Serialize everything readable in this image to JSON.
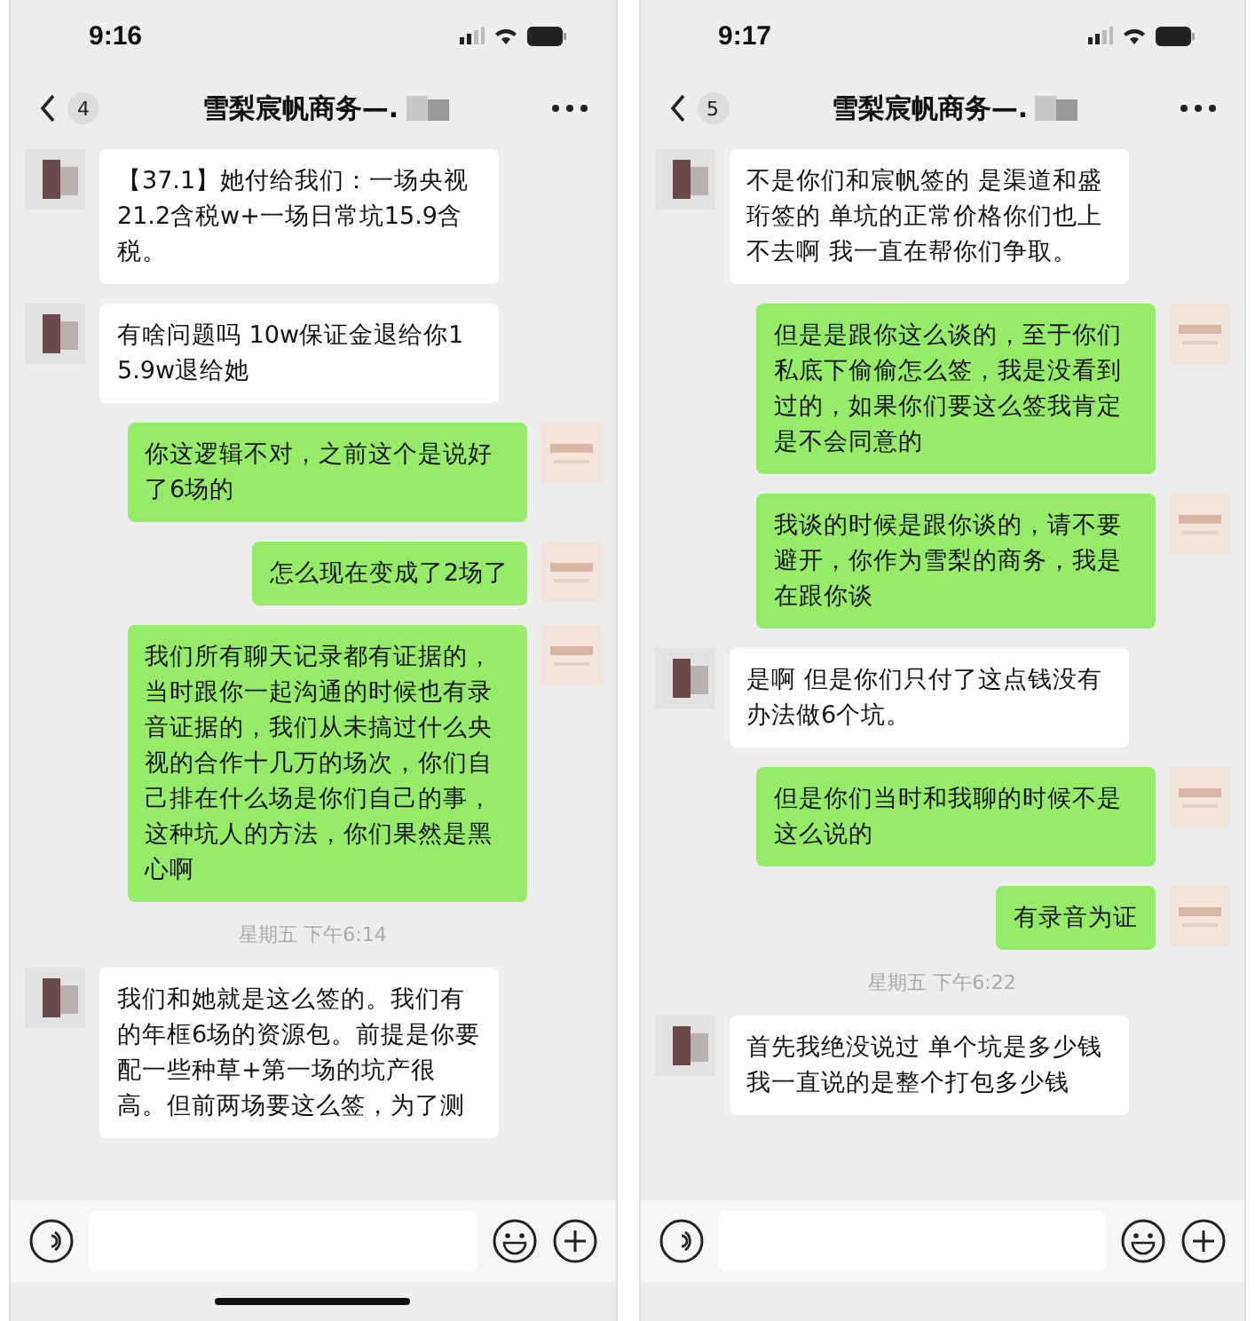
{
  "phones": [
    {
      "status_bar": {
        "time": "9:16"
      },
      "header": {
        "unread_count": "4",
        "title": "雪梨宸帆商务—."
      },
      "home_indicator": true,
      "messages": [
        {
          "kind": "received",
          "text": "【37.1】她付给我们：一场央视21.2含税w+一场日常坑15.9含税。"
        },
        {
          "kind": "received",
          "text": "有啥问题吗 10w保证金退给你15.9w退给她"
        },
        {
          "kind": "sent",
          "text": "你这逻辑不对，之前这个是说好了6场的"
        },
        {
          "kind": "sent",
          "text": "怎么现在变成了2场了"
        },
        {
          "kind": "sent",
          "text": "我们所有聊天记录都有证据的，当时跟你一起沟通的时候也有录音证据的，我们从未搞过什么央视的合作十几万的场次，你们自己排在什么场是你们自己的事，这种坑人的方法，你们果然是黑心啊"
        },
        {
          "kind": "timestamp",
          "text": "星期五 下午6:14"
        },
        {
          "kind": "received",
          "text": "我们和她就是这么签的。我们有的年框6场的资源包。前提是你要配一些种草+第一场的坑产很高。但前两场要这么签，为了测"
        }
      ]
    },
    {
      "status_bar": {
        "time": "9:17"
      },
      "header": {
        "unread_count": "5",
        "title": "雪梨宸帆商务—."
      },
      "home_indicator": false,
      "messages": [
        {
          "kind": "received",
          "text": "不是你们和宸帆签的 是渠道和盛珩签的 单坑的正常价格你们也上不去啊 我一直在帮你们争取。"
        },
        {
          "kind": "sent",
          "text": "但是是跟你这么谈的，至于你们私底下偷偷怎么签，我是没看到过的，如果你们要这么签我肯定是不会同意的"
        },
        {
          "kind": "sent",
          "text": "我谈的时候是跟你谈的，请不要避开，你作为雪梨的商务，我是在跟你谈"
        },
        {
          "kind": "received",
          "text": "是啊 但是你们只付了这点钱没有办法做6个坑。"
        },
        {
          "kind": "sent",
          "text": "但是你们当时和我聊的时候不是这么说的"
        },
        {
          "kind": "sent",
          "text": "有录音为证"
        },
        {
          "kind": "timestamp",
          "text": "星期五 下午6:22"
        },
        {
          "kind": "received",
          "text": "首先我绝没说过 单个坑是多少钱我一直说的是整个打包多少钱"
        }
      ]
    }
  ]
}
